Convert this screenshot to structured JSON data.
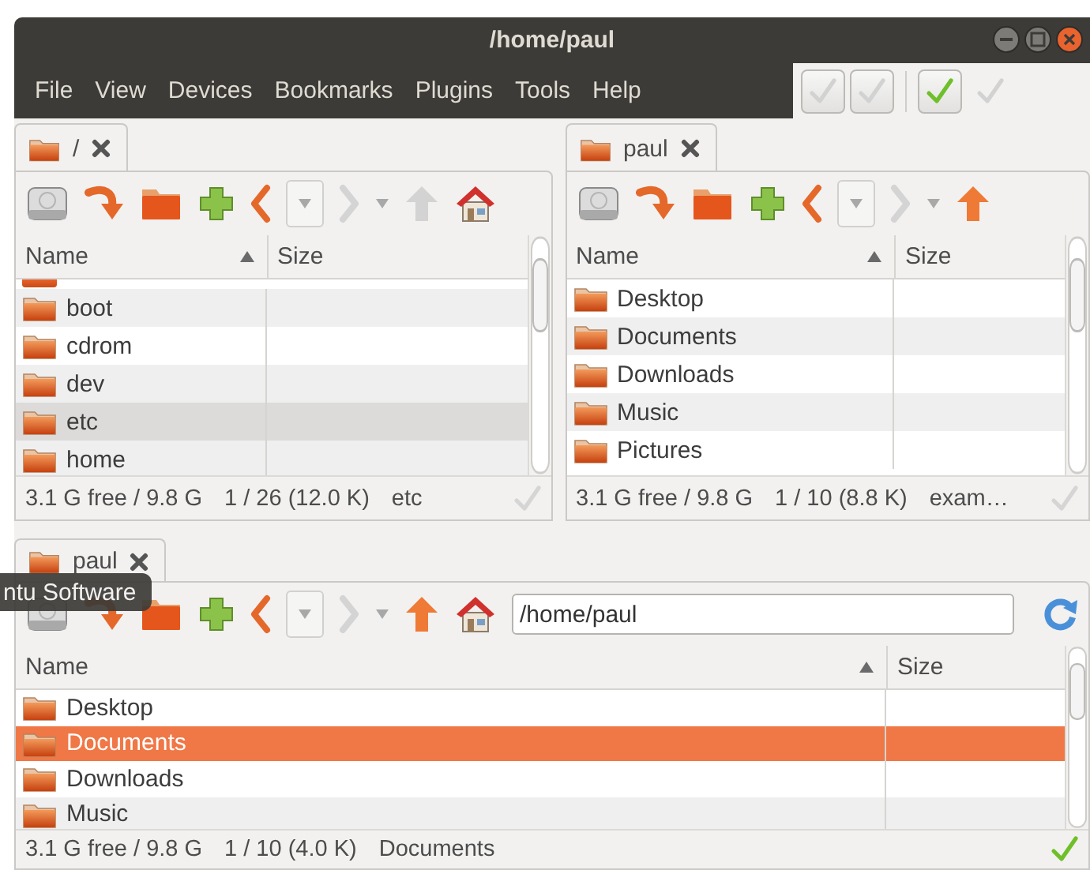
{
  "window": {
    "title": "/home/paul"
  },
  "menu": [
    "File",
    "View",
    "Devices",
    "Bookmarks",
    "Plugins",
    "Tools",
    "Help"
  ],
  "toolbar_checks": [
    {
      "kind": "button",
      "on": false
    },
    {
      "kind": "button",
      "on": false
    },
    {
      "kind": "separator"
    },
    {
      "kind": "button",
      "on": true
    },
    {
      "kind": "plain",
      "on": false
    }
  ],
  "panes": [
    {
      "tab": "/",
      "active": false,
      "up_enabled": false,
      "home": true,
      "cut_row_above": true,
      "columns": [
        "Name",
        "Size"
      ],
      "rows": [
        {
          "name": "boot",
          "selected": false
        },
        {
          "name": "cdrom",
          "selected": false
        },
        {
          "name": "dev",
          "selected": false
        },
        {
          "name": "etc",
          "selected": true
        },
        {
          "name": "home",
          "selected": false
        }
      ],
      "status": {
        "free": "3.1 G free / 9.8 G",
        "count": "1 / 26 (12.0 K)",
        "current": "etc"
      }
    },
    {
      "tab": "paul",
      "active": false,
      "up_enabled": true,
      "home": false,
      "cut_row_above": false,
      "columns": [
        "Name",
        "Size"
      ],
      "rows": [
        {
          "name": "Desktop",
          "selected": false
        },
        {
          "name": "Documents",
          "selected": false
        },
        {
          "name": "Downloads",
          "selected": false
        },
        {
          "name": "Music",
          "selected": false
        },
        {
          "name": "Pictures",
          "selected": false
        }
      ],
      "status": {
        "free": "3.1 G free / 9.8 G",
        "count": "1 / 10 (8.8 K)",
        "current": "exam…"
      }
    },
    {
      "tab": "paul",
      "active": true,
      "up_enabled": true,
      "home": true,
      "path": "/home/paul",
      "cut_row_above": false,
      "columns": [
        "Name",
        "Size"
      ],
      "rows": [
        {
          "name": "Desktop",
          "selected": false
        },
        {
          "name": "Documents",
          "selected": true
        },
        {
          "name": "Downloads",
          "selected": false
        },
        {
          "name": "Music",
          "selected": false
        }
      ],
      "status": {
        "free": "3.1 G free / 9.8 G",
        "count": "1 / 10 (4.0 K)",
        "current": "Documents"
      }
    }
  ],
  "tooltip": "ntu Software"
}
